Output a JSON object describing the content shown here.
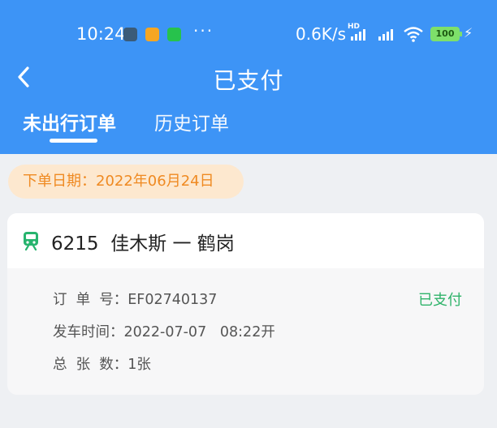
{
  "status_bar": {
    "time": "10:24",
    "more": "···",
    "net_speed": "0.6K/s",
    "hd": "HD",
    "battery": "100",
    "colors": {
      "app_icon_1": "#5b9bd5",
      "app_icon_2": "#f5a623",
      "app_icon_3": "#27c24c"
    }
  },
  "header": {
    "title": "已支付",
    "tabs": [
      {
        "label": "未出行订单",
        "active": true
      },
      {
        "label": "历史订单",
        "active": false
      }
    ],
    "back_icon": "chevron-left-icon"
  },
  "order": {
    "date_label": "下单日期：2022年06月24日",
    "train_number": "6215",
    "route": "佳木斯 一 鹤岗",
    "train_icon": "train-icon",
    "status": "已支付",
    "order_no_label": "订  单  号：EF02740137",
    "departure_label": "发车时间：2022-07-07   08:22开",
    "count_label": "总  张  数：1张"
  },
  "colors": {
    "header_bg": "#3d94f6",
    "page_bg": "#eef0f3",
    "date_pill_bg": "#fde8cf",
    "date_text": "#ef8a22",
    "status_green": "#2fb36a",
    "train_icon_green": "#27b46e"
  }
}
